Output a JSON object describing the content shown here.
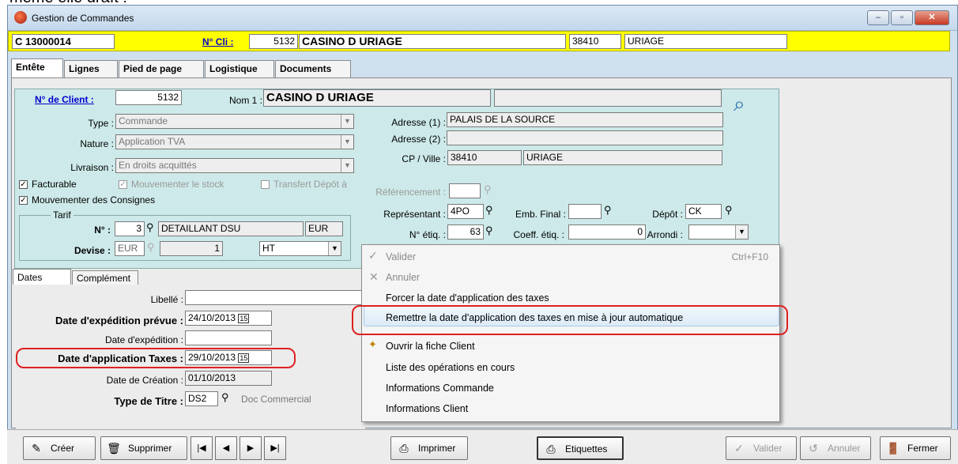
{
  "hint_text": "même elle draît !",
  "window": {
    "title": "Gestion de Commandes",
    "btn_min": "–",
    "btn_max": "▫",
    "btn_close": "✕"
  },
  "header": {
    "order_no": "C 13000014",
    "ncli_label": "N° Cli :",
    "ncli_value": "5132",
    "client_name": "CASINO D URIAGE",
    "postcode": "38410",
    "city": "URIAGE"
  },
  "tabs": [
    "Entête",
    "Lignes",
    "Pied de page",
    "Logistique",
    "Documents"
  ],
  "entete": {
    "nclient_label": "N° de Client :",
    "nclient_value": "5132",
    "nom1_label": "Nom 1 :",
    "nom1_value": "CASINO D URIAGE",
    "nom2_value": "",
    "type_label": "Type :",
    "type_value": "Commande",
    "nature_label": "Nature :",
    "nature_value": "Application TVA",
    "livraison_label": "Livraison :",
    "livraison_value": "En droits acquittés",
    "adr1_label": "Adresse (1) :",
    "adr1_value": "PALAIS DE LA SOURCE",
    "adr2_label": "Adresse (2) :",
    "adr2_value": "",
    "cpville_label": "CP / Ville :",
    "cp_value": "38410",
    "ville_value": "URIAGE",
    "facturable_label": "Facturable",
    "mvt_stock_label": "Mouvementer le stock",
    "transfert_label": "Transfert Dépôt à",
    "referencement_label": "Référencement :",
    "mvt_consignes_label": "Mouvementer des Consignes",
    "tarif_legend": "Tarif",
    "n_label": "N° :",
    "n_value": "3",
    "tarif_name": "DETAILLANT DSU",
    "tarif_currency": "EUR",
    "devise_label": "Devise :",
    "devise_value": "EUR",
    "devise_rate": "1",
    "ht_value": "HT",
    "representant_label": "Représentant :",
    "representant_value": "4PO",
    "emb_final_label": "Emb. Final :",
    "emb_final_value": "",
    "depot_label": "Dépôt :",
    "depot_value": "CK",
    "netiq_label": "N° étiq. :",
    "netiq_value": "63",
    "coeff_label": "Coeff. étiq. :",
    "coeff_value": "0",
    "arrondi_label": "Arrondi :",
    "arrondi_value": ""
  },
  "subtabs": [
    "Dates",
    "Complément"
  ],
  "dates": {
    "libelle_label": "Libellé :",
    "libelle_value": "",
    "exp_prevue_label": "Date d'expédition prévue :",
    "exp_prevue_value": "24/10/2013",
    "exp_label": "Date d'expédition :",
    "exp_value": "",
    "app_taxes_label": "Date d'application Taxes :",
    "app_taxes_value": "29/10/2013",
    "creation_label": "Date de Création :",
    "creation_value": "01/10/2013",
    "type_titre_label": "Type de Titre :",
    "type_titre_value": "DS2",
    "type_titre_desc": "Doc Commercial",
    "cal_glyph": "15"
  },
  "context_menu": {
    "items": [
      {
        "label": "Valider",
        "shortcut": "Ctrl+F10",
        "disabled": true
      },
      {
        "label": "Annuler",
        "disabled": true
      },
      {
        "label": "Forcer la date d'application des taxes"
      },
      {
        "label": "Remettre la date d'application des taxes en mise à jour automatique"
      },
      {
        "label": "Ouvrir la fiche Client"
      },
      {
        "label": "Liste des opérations en cours"
      },
      {
        "label": "Informations Commande"
      },
      {
        "label": "Informations Client"
      }
    ]
  },
  "toolbar": {
    "creer": "Créer",
    "supprimer": "Supprimer",
    "imprimer": "Imprimer",
    "etiquettes": "Etiquettes",
    "valider": "Valider",
    "annuler": "Annuler",
    "fermer": "Fermer",
    "nav_first": "|◀",
    "nav_prev": "◀",
    "nav_next": "▶",
    "nav_last": "▶|"
  },
  "colors": {
    "header_yellow": "#ffff00",
    "panel_cyan": "#cde9e9",
    "highlight_red": "#e02020"
  }
}
